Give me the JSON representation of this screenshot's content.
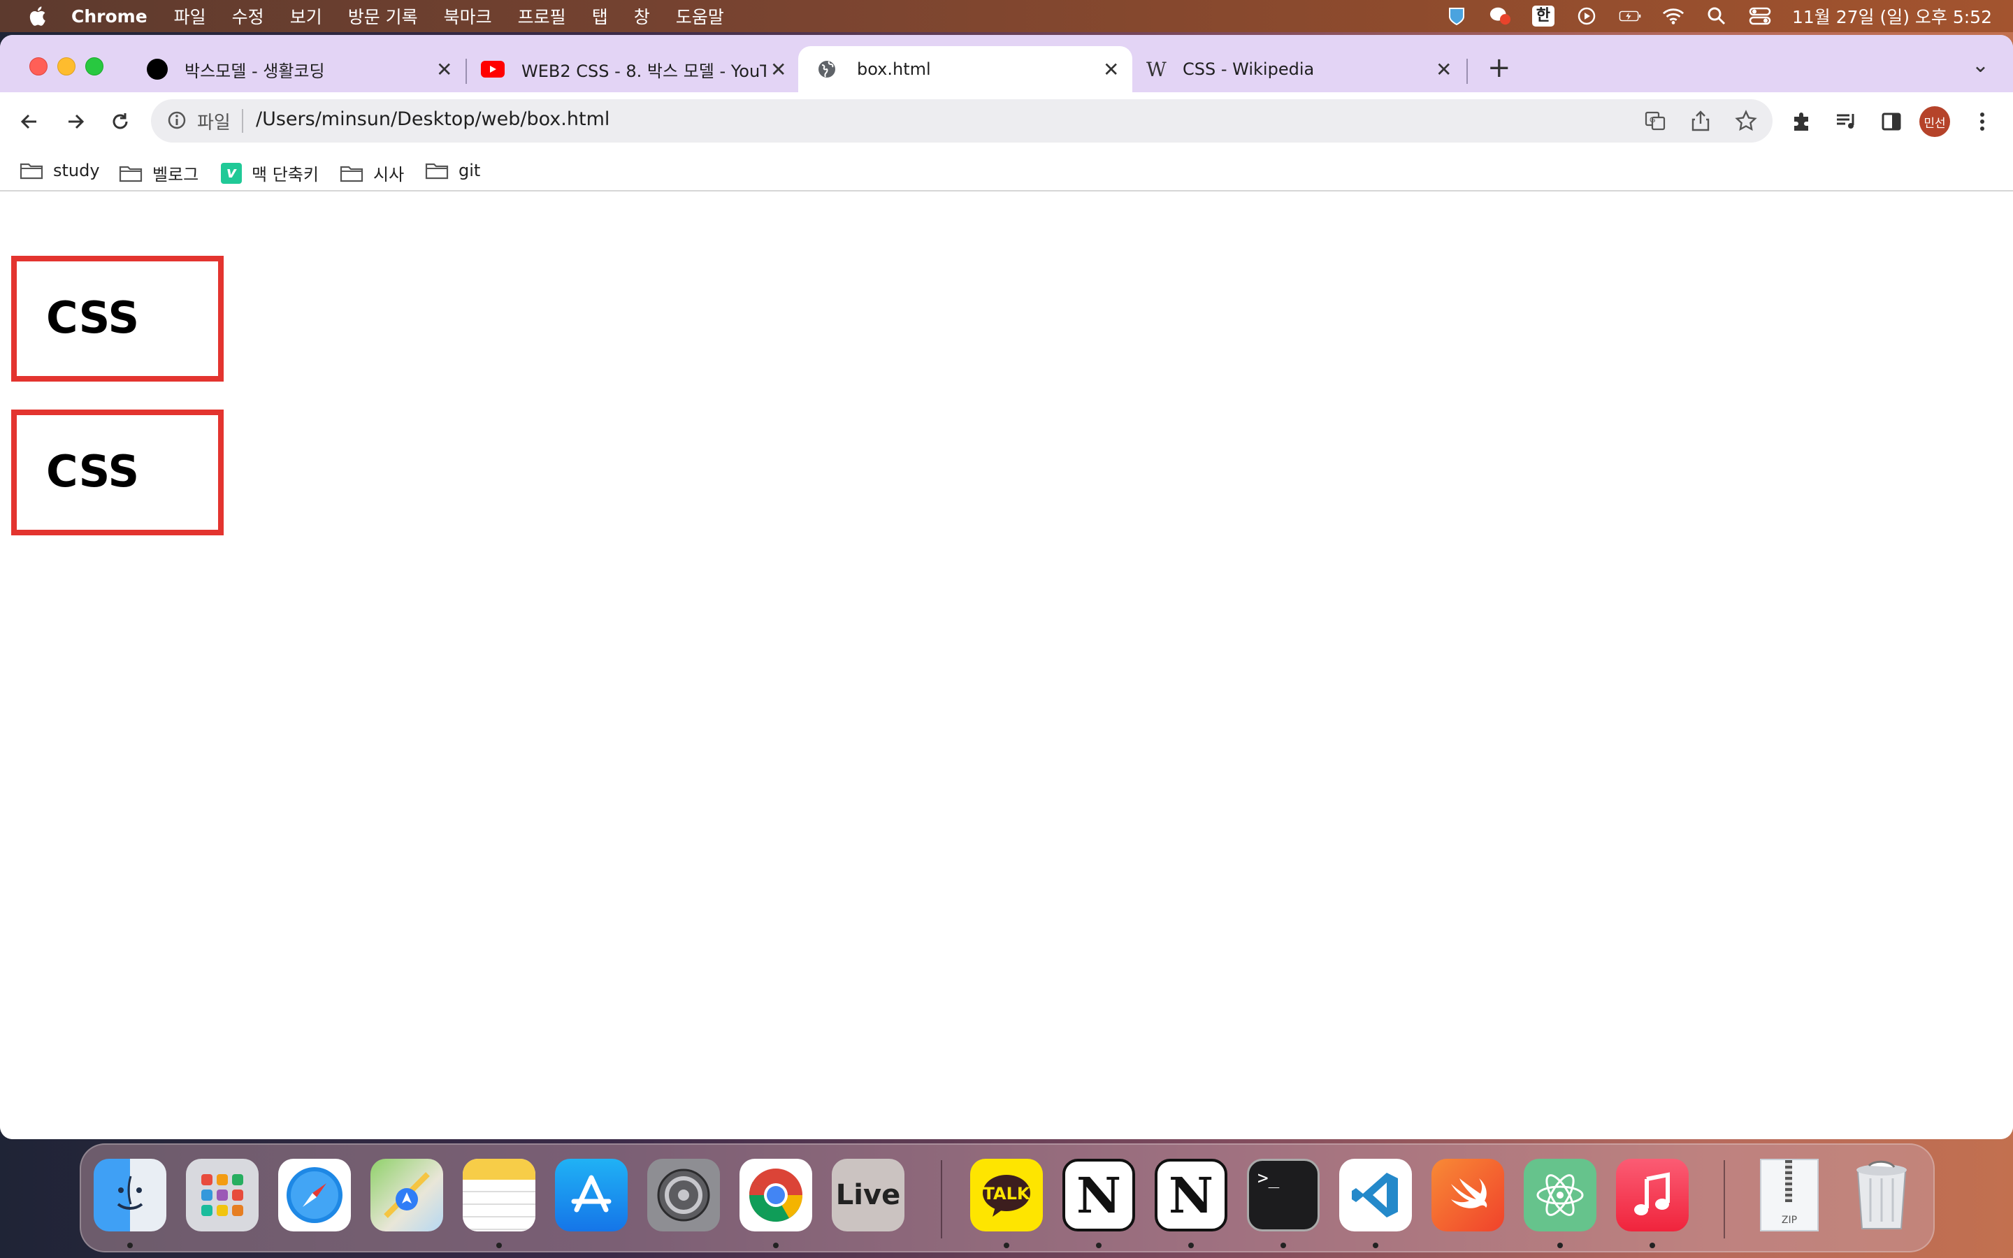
{
  "menubar": {
    "app_name": "Chrome",
    "items": [
      "파일",
      "수정",
      "보기",
      "방문 기록",
      "북마크",
      "프로필",
      "탭",
      "창",
      "도움말"
    ],
    "ime": "한",
    "clock": "11월 27일 (일) 오후 5:52"
  },
  "tabs": [
    {
      "title": "박스모델 - 생활코딩",
      "icon": "black-dot-icon"
    },
    {
      "title": "WEB2 CSS - 8. 박스 모델 - YouTu",
      "icon": "youtube-icon"
    },
    {
      "title": "box.html",
      "icon": "globe-icon"
    },
    {
      "title": "CSS - Wikipedia",
      "icon": "wikipedia-icon"
    }
  ],
  "omnibox": {
    "scheme": "파일",
    "url": "/Users/minsun/Desktop/web/box.html"
  },
  "profile": {
    "initials": "민선",
    "color": "#b5432a"
  },
  "bookmarks": [
    {
      "label": "study",
      "icon": "folder-icon"
    },
    {
      "label": "벨로그",
      "icon": "folder-icon"
    },
    {
      "label": "맥 단축키",
      "icon": "velog-icon"
    },
    {
      "label": "시사",
      "icon": "folder-icon"
    },
    {
      "label": "git",
      "icon": "folder-icon"
    }
  ],
  "page": {
    "boxes": [
      "CSS",
      "CSS"
    ],
    "border_color": "#e3342f"
  },
  "dock": {
    "apps": [
      "Finder",
      "Launchpad",
      "Safari",
      "Maps",
      "Notes",
      "App Store",
      "System Preferences",
      "Chrome",
      "Live",
      "KakaoTalk",
      "Notion",
      "Notion",
      "Terminal",
      "VS Code",
      "Swift Playgrounds",
      "Atom",
      "Music",
      "Archive",
      "Trash"
    ],
    "live_label": "Live",
    "talk_label": "TALK",
    "zip_label": "ZIP"
  }
}
